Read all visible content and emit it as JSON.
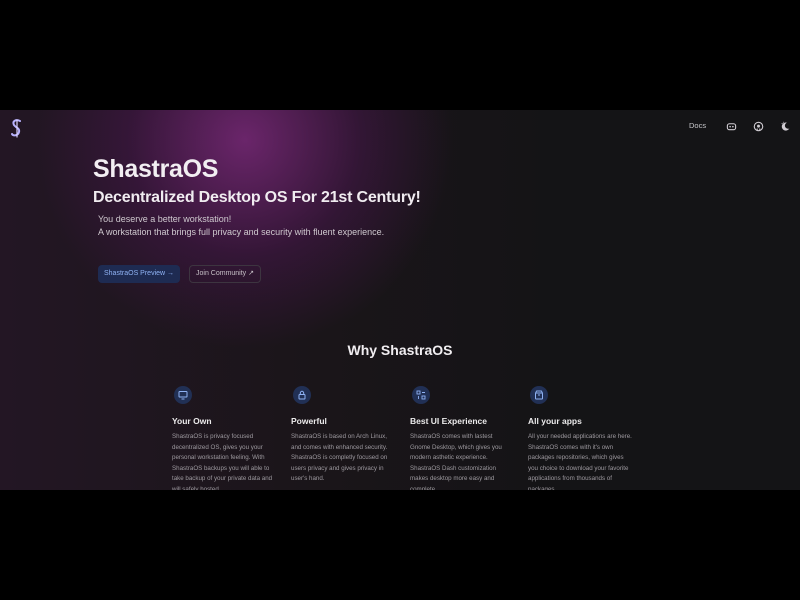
{
  "nav": {
    "logo_icon": "shastra-logo-icon",
    "docs_label": "Docs",
    "icons": [
      "discord-icon",
      "github-icon",
      "theme-toggle-icon"
    ]
  },
  "hero": {
    "title": "ShastraOS",
    "subtitle": "Decentralized Desktop OS For 21st Century!",
    "line1": "You deserve a better workstation!",
    "line2": "A workstation that brings full privacy and security with fluent experience.",
    "primary_button": "ShastraOS Preview →",
    "secondary_button": "Join Community ↗"
  },
  "why": {
    "title": "Why ShastraOS",
    "features": [
      {
        "icon": "monitor-icon",
        "title": "Your Own",
        "description": "ShastraOS is privacy focused decentralized OS, gives you your personal workstation feeling. With ShastraOS backups you will able to take backup of your private data and will safely hosted"
      },
      {
        "icon": "lock-icon",
        "title": "Powerful",
        "description": "ShastraOS is based on Arch Linux, and comes with enhanced security. ShastraOS is completly focused on users privacy and gives privacy in user's hand."
      },
      {
        "icon": "ui-layout-icon",
        "title": "Best UI Experience",
        "description": "ShastraOS comes with lastest Gnome Desktop, which gives you modern asthetic experience. ShastraOS Dash customization makes desktop more easy and complete."
      },
      {
        "icon": "package-icon",
        "title": "All your apps",
        "description": "All your needed applications are here. ShastraOS comes with it's own packages repositories, which gives you choice to download your favorite applications from thousands of packages."
      }
    ]
  },
  "colors": {
    "accent": "#8fb2f4",
    "button_bg": "#1e2b52",
    "glow": "#782878"
  }
}
